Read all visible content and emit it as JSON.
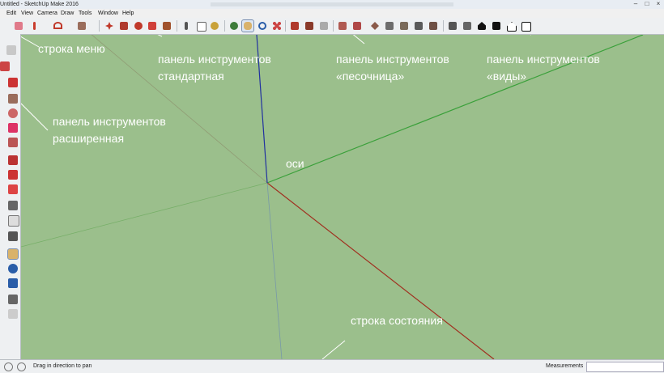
{
  "window": {
    "title": "Untitled - SketchUp Make 2016",
    "controls": [
      "–",
      "□",
      "×"
    ]
  },
  "menu": [
    "Edit",
    "View",
    "Camera",
    "Draw",
    "Tools",
    "Window",
    "Help"
  ],
  "toolbar_icons": [
    "eraser-icon",
    "pencil-icon",
    "arc-icon",
    "rectangle-icon",
    "move-icon",
    "pushpull-icon",
    "rotate-icon",
    "followme-icon",
    "scale-icon",
    "offset-icon",
    "tape-icon",
    "text-icon",
    "paint-icon",
    "orbit-icon",
    "pan-icon",
    "zoom-icon",
    "zoom-extents-icon",
    "warehouse-icon",
    "components-icon",
    "share-icon",
    "sandbox-from-contours-icon",
    "sandbox-from-scratch-icon",
    "smoove-icon",
    "stamp-icon",
    "drape-icon",
    "add-detail-icon",
    "flip-edge-icon",
    "iso-view-icon",
    "top-view-icon",
    "front-view-icon",
    "right-view-icon",
    "back-view-icon",
    "left-view-icon"
  ],
  "annotations": {
    "menu_row": "строка меню",
    "std_line1": "панель инструментов",
    "std_line2": "стандартная",
    "sandbox_line1": "панель инструментов",
    "sandbox_line2": "«песочница»",
    "views_line1": "панель инструментов",
    "views_line2": "«виды»",
    "ext_line1": "панель инструментов",
    "ext_line2": "расширенная",
    "axes": "оси",
    "status_row": "строка состояния"
  },
  "axes_colors": {
    "blue": "#2030a0",
    "green": "#3aa03a",
    "red": "#a03020"
  },
  "status": {
    "hint": "Drag in direction to pan",
    "measurements_label": "Measurements",
    "measurements_value": ""
  }
}
